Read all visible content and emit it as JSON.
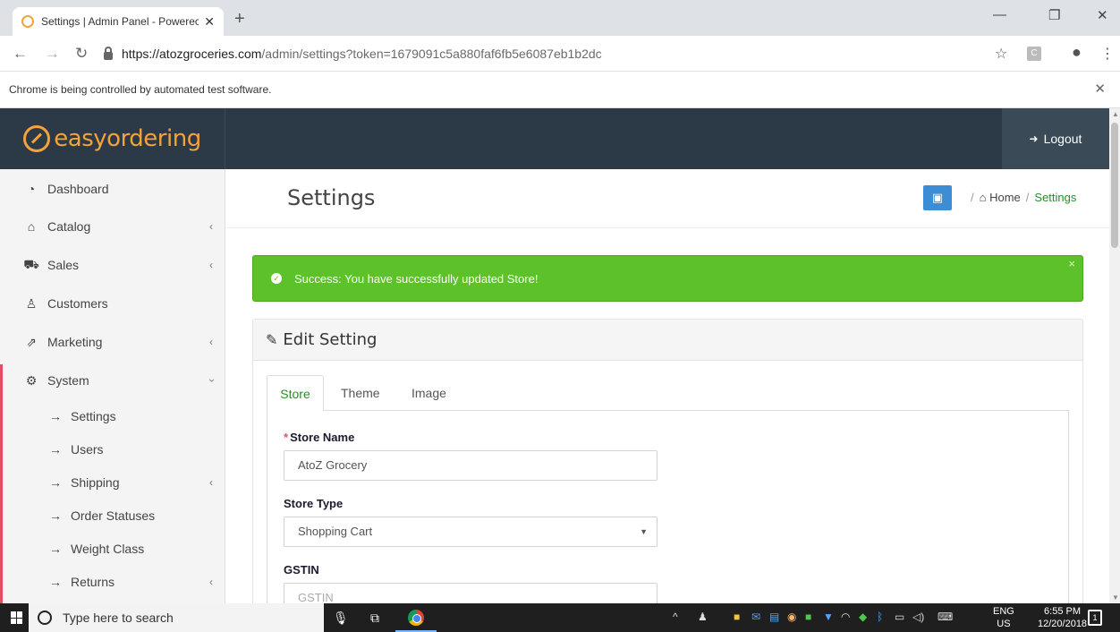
{
  "browser": {
    "tab_title": "Settings | Admin Panel - Powerec",
    "url_host": "https://atozgroceries.com",
    "url_path": "/admin/settings?token=1679091c5a880faf6fb5e6087eb1b2dc",
    "infobar_message": "Chrome is being controlled by automated test software."
  },
  "header": {
    "logo_text": "easyordering",
    "logout_label": "Logout"
  },
  "sidebar": {
    "items": [
      {
        "label": "Dashboard"
      },
      {
        "label": "Catalog"
      },
      {
        "label": "Sales"
      },
      {
        "label": "Customers"
      },
      {
        "label": "Marketing"
      },
      {
        "label": "System"
      }
    ],
    "system_children": [
      {
        "label": "Settings"
      },
      {
        "label": "Users"
      },
      {
        "label": "Shipping"
      },
      {
        "label": "Order Statuses"
      },
      {
        "label": "Weight Class"
      },
      {
        "label": "Returns"
      }
    ]
  },
  "page": {
    "title": "Settings",
    "breadcrumb": {
      "home": "Home",
      "current": "Settings"
    },
    "alert": "Success: You have successfully updated Store!",
    "panel_title": "Edit Setting",
    "tabs": [
      "Store",
      "Theme",
      "Image"
    ],
    "form": {
      "store_name_label": "Store Name",
      "store_name_value": "AtoZ Grocery",
      "store_type_label": "Store Type",
      "store_type_value": "Shopping Cart",
      "gstin_label": "GSTIN",
      "gstin_placeholder": "GSTIN"
    }
  },
  "taskbar": {
    "search_placeholder": "Type here to search",
    "lang_top": "ENG",
    "lang_bottom": "US",
    "time": "6:55 PM",
    "date": "12/20/2018",
    "notification_count": "1"
  }
}
